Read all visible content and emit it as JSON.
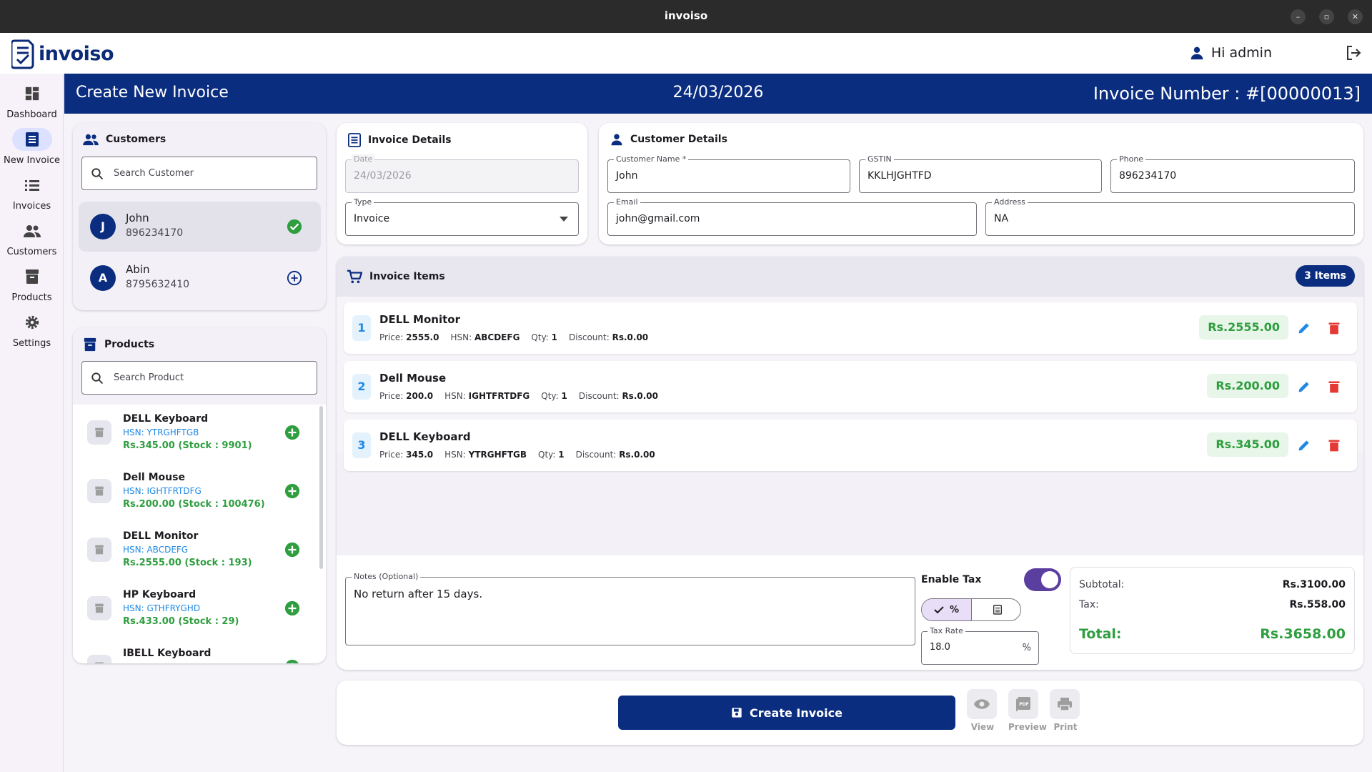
{
  "window": {
    "title": "invoiso"
  },
  "header": {
    "app_name": "invoiso",
    "greeting": "Hi admin"
  },
  "sidebar": {
    "items": [
      {
        "label": "Dashboard",
        "icon": "dashboard-icon"
      },
      {
        "label": "New Invoice",
        "icon": "receipt-icon",
        "active": true
      },
      {
        "label": "Invoices",
        "icon": "list-icon"
      },
      {
        "label": "Customers",
        "icon": "people-icon"
      },
      {
        "label": "Products",
        "icon": "archive-icon"
      },
      {
        "label": "Settings",
        "icon": "gear-icon"
      }
    ]
  },
  "titlebar": {
    "title": "Create New Invoice",
    "date": "24/03/2026",
    "invoice_number": "Invoice Number : #[00000013]"
  },
  "customers": {
    "title": "Customers",
    "search_placeholder": "Search Customer",
    "list": [
      {
        "initial": "J",
        "name": "John",
        "phone": "896234170",
        "selected": true
      },
      {
        "initial": "A",
        "name": "Abin",
        "phone": "8795632410",
        "selected": false
      }
    ]
  },
  "products": {
    "title": "Products",
    "search_placeholder": "Search Product",
    "list": [
      {
        "name": "DELL Keyboard",
        "hsn": "HSN: YTRGHFTGB",
        "price_stock": "Rs.345.00  (Stock : 9901)"
      },
      {
        "name": "Dell Mouse",
        "hsn": "HSN: IGHTFRTDFG",
        "price_stock": "Rs.200.00  (Stock : 100476)"
      },
      {
        "name": "DELL Monitor",
        "hsn": "HSN: ABCDEFG",
        "price_stock": "Rs.2555.00  (Stock : 193)"
      },
      {
        "name": "HP Keyboard",
        "hsn": "HSN: GTHFRYGHD",
        "price_stock": "Rs.433.00  (Stock : 29)"
      },
      {
        "name": "IBELL Keyboard",
        "hsn": "",
        "price_stock": ""
      }
    ]
  },
  "invoice_details": {
    "title": "Invoice Details",
    "date_label": "Date",
    "date_value": "24/03/2026",
    "type_label": "Type",
    "type_value": "Invoice"
  },
  "customer_details": {
    "title": "Customer Details",
    "name_label": "Customer Name *",
    "name_value": "John",
    "gstin_label": "GSTIN",
    "gstin_value": "KKLHJGHTFD",
    "phone_label": "Phone",
    "phone_value": "896234170",
    "email_label": "Email",
    "email_value": "john@gmail.com",
    "address_label": "Address",
    "address_value": "NA"
  },
  "invoice_items": {
    "title": "Invoice Items",
    "count_badge": "3 Items",
    "labels": {
      "price": "Price:",
      "hsn": "HSN:",
      "qty": "Qty:",
      "discount": "Discount:"
    },
    "rows": [
      {
        "index": "1",
        "name": "DELL Monitor",
        "price": "2555.0",
        "hsn": "ABCDEFG",
        "qty": "1",
        "discount": "Rs.0.00",
        "total": "Rs.2555.00"
      },
      {
        "index": "2",
        "name": "Dell Mouse",
        "price": "200.0",
        "hsn": "IGHTFRTDFG",
        "qty": "1",
        "discount": "Rs.0.00",
        "total": "Rs.200.00"
      },
      {
        "index": "3",
        "name": "DELL Keyboard",
        "price": "345.0",
        "hsn": "YTRGHFTGB",
        "qty": "1",
        "discount": "Rs.0.00",
        "total": "Rs.345.00"
      }
    ]
  },
  "notes": {
    "label": "Notes (Optional)",
    "value": "No return after 15 days."
  },
  "tax": {
    "enable_label": "Enable Tax",
    "enabled": true,
    "mode_percent": "%",
    "rate_label": "Tax Rate",
    "rate_value": "18.0",
    "rate_suffix": "%"
  },
  "summary": {
    "subtotal_label": "Subtotal:",
    "subtotal": "Rs.3100.00",
    "tax_label": "Tax:",
    "tax": "Rs.558.00",
    "total_label": "Total:",
    "total": "Rs.3658.00"
  },
  "actions": {
    "create": "Create Invoice",
    "view": "View",
    "preview": "Preview",
    "print": "Print"
  },
  "colors": {
    "brand": "#0b2d80",
    "accent_green": "#2e9e3f",
    "accent_blue": "#1e88e5",
    "danger": "#e53935",
    "toggle": "#5a3fa0"
  }
}
